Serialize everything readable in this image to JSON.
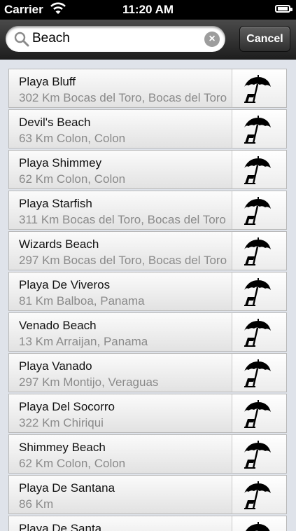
{
  "status_bar": {
    "carrier": "Carrier",
    "time": "11:20 AM"
  },
  "search": {
    "value": "Beach",
    "cancel_label": "Cancel"
  },
  "results": [
    {
      "name": "Playa Bluff",
      "detail": "302 Km Bocas del Toro, Bocas del Toro"
    },
    {
      "name": "Devil's Beach",
      "detail": "63 Km Colon, Colon"
    },
    {
      "name": "Playa Shimmey",
      "detail": "62 Km Colon, Colon"
    },
    {
      "name": "Playa Starfish",
      "detail": "311 Km Bocas del Toro, Bocas del Toro"
    },
    {
      "name": "Wizards Beach",
      "detail": "297 Km Bocas del Toro, Bocas del Toro"
    },
    {
      "name": "Playa De Viveros",
      "detail": "81 Km Balboa, Panama"
    },
    {
      "name": "Venado Beach",
      "detail": "13 Km Arraijan, Panama"
    },
    {
      "name": "Playa Vanado",
      "detail": "297 Km Montijo, Veraguas"
    },
    {
      "name": "Playa Del Socorro",
      "detail": "322 Km Chiriqui"
    },
    {
      "name": "Shimmey Beach",
      "detail": "62 Km Colon, Colon"
    },
    {
      "name": "Playa De Santana",
      "detail": "86 Km"
    },
    {
      "name": "Playa De Santa",
      "detail": ""
    }
  ],
  "icons": {
    "row_icon": "beach-umbrella-chair-icon",
    "search": "search-icon",
    "clear": "clear-icon"
  }
}
